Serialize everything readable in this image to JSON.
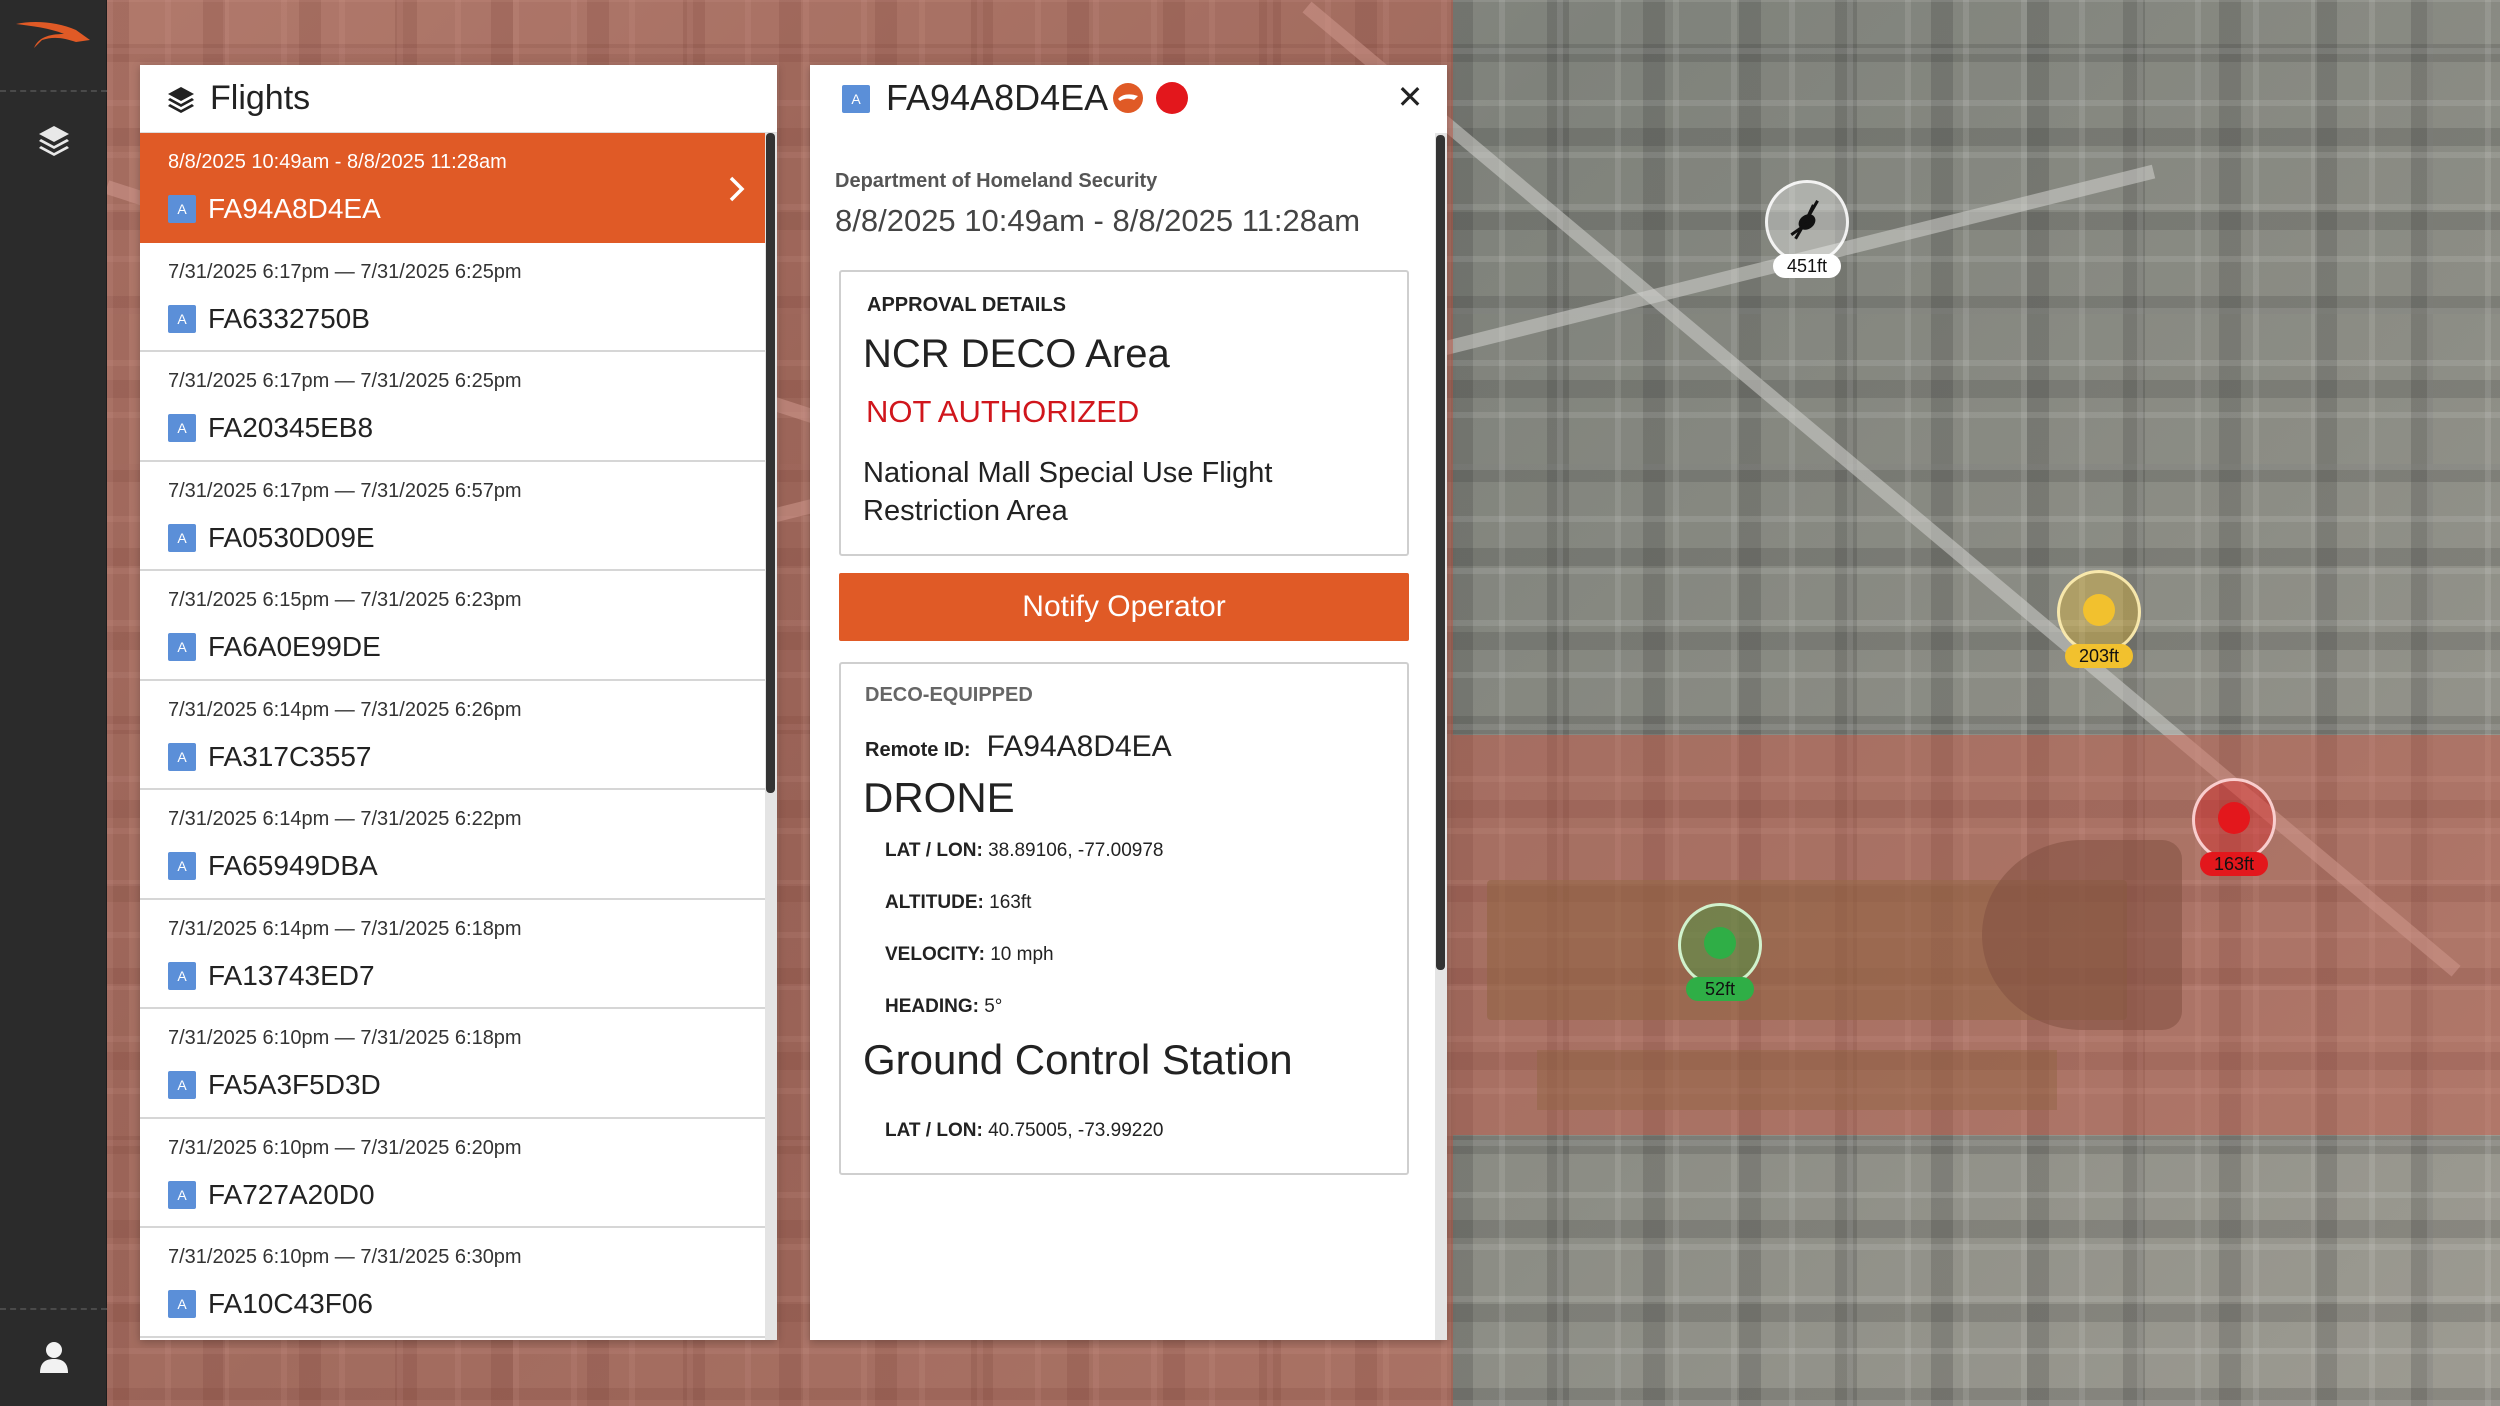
{
  "colors": {
    "accent": "#e05a26",
    "badge_blue": "#5b8fd8",
    "alert_red": "#d0161c",
    "marker_red": "#e3171c",
    "marker_yellow": "#f2c12e",
    "marker_green": "#2fae46"
  },
  "flights_panel": {
    "title": "Flights",
    "items": [
      {
        "time": "8/8/2025 10:49am - 8/8/2025 11:28am",
        "badge": "A",
        "id": "FA94A8D4EA",
        "selected": true
      },
      {
        "time": "7/31/2025 6:17pm — 7/31/2025 6:25pm",
        "badge": "A",
        "id": "FA6332750B"
      },
      {
        "time": "7/31/2025 6:17pm — 7/31/2025 6:25pm",
        "badge": "A",
        "id": "FA20345EB8"
      },
      {
        "time": "7/31/2025 6:17pm — 7/31/2025 6:57pm",
        "badge": "A",
        "id": "FA0530D09E"
      },
      {
        "time": "7/31/2025 6:15pm — 7/31/2025 6:23pm",
        "badge": "A",
        "id": "FA6A0E99DE"
      },
      {
        "time": "7/31/2025 6:14pm — 7/31/2025 6:26pm",
        "badge": "A",
        "id": "FA317C3557"
      },
      {
        "time": "7/31/2025 6:14pm — 7/31/2025 6:22pm",
        "badge": "A",
        "id": "FA65949DBA"
      },
      {
        "time": "7/31/2025 6:14pm — 7/31/2025 6:18pm",
        "badge": "A",
        "id": "FA13743ED7"
      },
      {
        "time": "7/31/2025 6:10pm — 7/31/2025 6:18pm",
        "badge": "A",
        "id": "FA5A3F5D3D"
      },
      {
        "time": "7/31/2025 6:10pm — 7/31/2025 6:20pm",
        "badge": "A",
        "id": "FA727A20D0"
      },
      {
        "time": "7/31/2025 6:10pm — 7/31/2025 6:30pm",
        "badge": "A",
        "id": "FA10C43F06"
      }
    ]
  },
  "detail": {
    "badge": "A",
    "remote_id": "FA94A8D4EA",
    "close_glyph": "✕",
    "organization": "Department of Homeland Security",
    "time_range": "8/8/2025 10:49am - 8/8/2025 11:28am",
    "approval": {
      "label": "APPROVAL DETAILS",
      "area": "NCR DECO Area",
      "status": "NOT AUTHORIZED",
      "description": "National Mall Special Use Flight Restriction Area"
    },
    "notify_button": "Notify Operator",
    "deco": {
      "label": "DECO-EQUIPPED",
      "remote_id_label": "Remote ID:",
      "remote_id_value": "FA94A8D4EA",
      "drone_heading": "DRONE",
      "drone_latlon_label": "LAT / LON:",
      "drone_latlon_value": "38.89106, -77.00978",
      "altitude_label": "ALTITUDE:",
      "altitude_value": "163ft",
      "velocity_label": "VELOCITY:",
      "velocity_value": "10 mph",
      "heading_label": "HEADING:",
      "heading_value": "5°",
      "gcs_heading": "Ground Control Station",
      "gcs_latlon_label": "LAT / LON:",
      "gcs_latlon_value": "40.75005, -73.99220"
    }
  },
  "map_markers": [
    {
      "kind": "helicopter-icon",
      "altitude": "451ft",
      "color": "#ffffff"
    },
    {
      "kind": "drone-icon",
      "altitude": "203ft",
      "color": "#f2c12e"
    },
    {
      "kind": "drone-icon",
      "altitude": "163ft",
      "color": "#e3171c"
    },
    {
      "kind": "drone-icon",
      "altitude": "52ft",
      "color": "#2fae46"
    }
  ]
}
